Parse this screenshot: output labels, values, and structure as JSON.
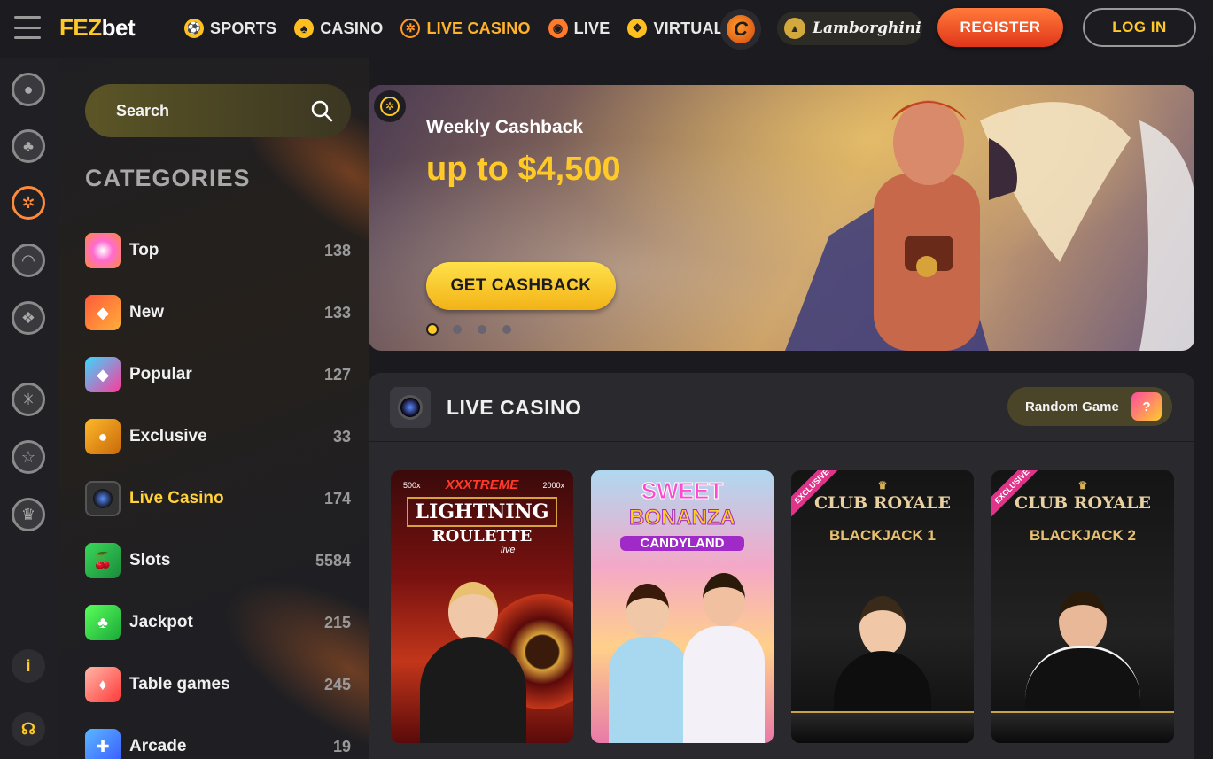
{
  "header": {
    "logo_left": "FEZ",
    "logo_right": "bet",
    "nav": [
      {
        "label": "SPORTS",
        "icon": "soccer-ball-icon",
        "active": false
      },
      {
        "label": "CASINO",
        "icon": "club-suit-icon",
        "active": false
      },
      {
        "label": "LIVE CASINO",
        "icon": "roulette-wheel-icon",
        "active": true
      },
      {
        "label": "LIVE",
        "icon": "live-signal-icon",
        "active": false
      },
      {
        "label": "VIRTUALS",
        "icon": "virtual-sports-icon",
        "active": false
      }
    ],
    "partner": "Lamborghini",
    "register_label": "REGISTER",
    "login_label": "LOG IN"
  },
  "rail": {
    "icons": [
      "soccer-ball-icon",
      "club-suit-icon",
      "roulette-wheel-icon",
      "live-signal-icon",
      "virtual-sports-icon",
      "tournament-icon",
      "star-icon",
      "trophy-icon",
      "info-icon",
      "support-headset-icon"
    ],
    "info_glyph": "i"
  },
  "sidebar": {
    "search_placeholder": "Search",
    "categories_title": "CATEGORIES",
    "categories": [
      {
        "label": "Top",
        "count": "138",
        "icon": "top-icon",
        "active": false
      },
      {
        "label": "New",
        "count": "133",
        "icon": "new-icon",
        "active": false
      },
      {
        "label": "Popular",
        "count": "127",
        "icon": "popular-icon",
        "active": false
      },
      {
        "label": "Exclusive",
        "count": "33",
        "icon": "exclusive-icon",
        "active": false
      },
      {
        "label": "Live Casino",
        "count": "174",
        "icon": "live-casino-icon",
        "active": true
      },
      {
        "label": "Slots",
        "count": "5584",
        "icon": "slots-icon",
        "active": false
      },
      {
        "label": "Jackpot",
        "count": "215",
        "icon": "jackpot-icon",
        "active": false
      },
      {
        "label": "Table games",
        "count": "245",
        "icon": "table-games-icon",
        "active": false
      },
      {
        "label": "Arcade",
        "count": "19",
        "icon": "arcade-icon",
        "active": false
      }
    ]
  },
  "banner": {
    "subtitle": "Weekly Cashback",
    "title": "up to $4,500",
    "cta_label": "GET CASHBACK",
    "slides": 4,
    "active_slide": 1
  },
  "live_casino": {
    "title": "LIVE CASINO",
    "random_label": "Random Game",
    "games": [
      {
        "name_top": "XXXTREME",
        "name_mid": "LIGHTNING",
        "name_bottom": "ROULETTE",
        "tag": "live",
        "exclusive": false
      },
      {
        "name_top": "SWEET",
        "name_mid": "BONANZA",
        "name_bottom": "CANDYLAND",
        "exclusive": false
      },
      {
        "name_top": "CLUB ROYALE",
        "name_mid": "BLACKJACK 1",
        "exclusive": true
      },
      {
        "name_top": "CLUB ROYALE",
        "name_mid": "BLACKJACK 2",
        "exclusive": true
      }
    ],
    "exclusive_label": "EXCLUSIVE",
    "multipliers": [
      "500x",
      "2000x"
    ]
  },
  "colors": {
    "accent": "#ffc928",
    "active_nav": "#ffb22a",
    "register": "#e0361a"
  }
}
